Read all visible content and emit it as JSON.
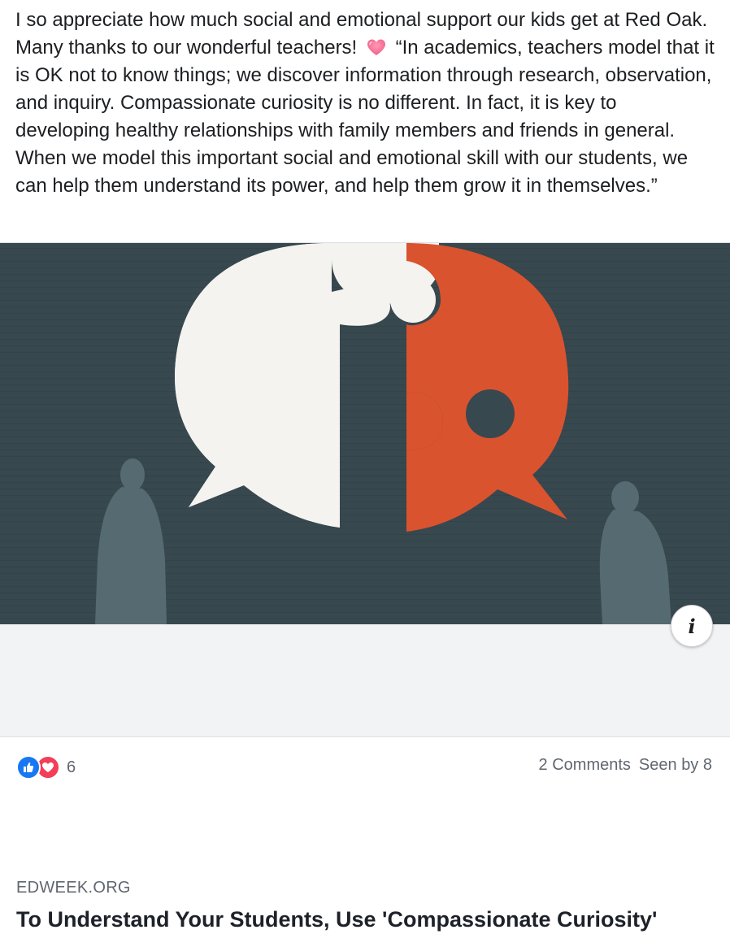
{
  "post": {
    "text_before_emoji": "I so appreciate how much social and emotional support our kids get at Red Oak. Many thanks to our wonderful teachers!",
    "emoji": "heart-emoji",
    "text_after_emoji": "“In academics, teachers model that it is OK not to know things; we discover information through research, observation, and inquiry. Compassionate curiosity is no different. In fact, it is key to developing healthy relationships with family members and friends in general. When we model this important social and emotional skill with our students, we can help them understand its power, and help them grow it in themselves.”"
  },
  "link_card": {
    "domain": "EDWEEK.ORG",
    "title": "To Understand Your Students, Use 'Compassionate Curiosity'",
    "info_icon": "i"
  },
  "footer": {
    "reaction_count": "6",
    "reaction_icons": [
      "like-icon",
      "love-icon"
    ],
    "comments_label": "2 Comments",
    "seen_by_label": "Seen by 8"
  },
  "colors": {
    "image_background": "#38484f",
    "puzzle_white": "#f4f3ef",
    "puzzle_orange": "#d9532f",
    "silhouette": "#566a71",
    "like_blue": "#1877f2",
    "love_red": "#f33e58"
  }
}
